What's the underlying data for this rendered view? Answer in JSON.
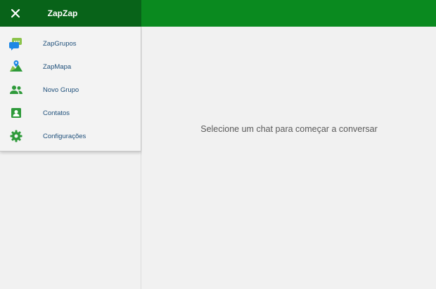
{
  "app": {
    "title": "ZapZap"
  },
  "colors": {
    "header": "#0a8a1f",
    "drawer_header": "#086319",
    "icon_green": "#2e9a3a"
  },
  "menu": {
    "items": [
      {
        "label": "ZapGrupos",
        "icon": "chat-bubbles-icon"
      },
      {
        "label": "ZapMapa",
        "icon": "map-icon"
      },
      {
        "label": "Novo Grupo",
        "icon": "group-icon"
      },
      {
        "label": "Contatos",
        "icon": "contact-card-icon"
      },
      {
        "label": "Configurações",
        "icon": "gear-icon"
      }
    ]
  },
  "main": {
    "empty_message": "Selecione um chat para começar a conversar"
  }
}
